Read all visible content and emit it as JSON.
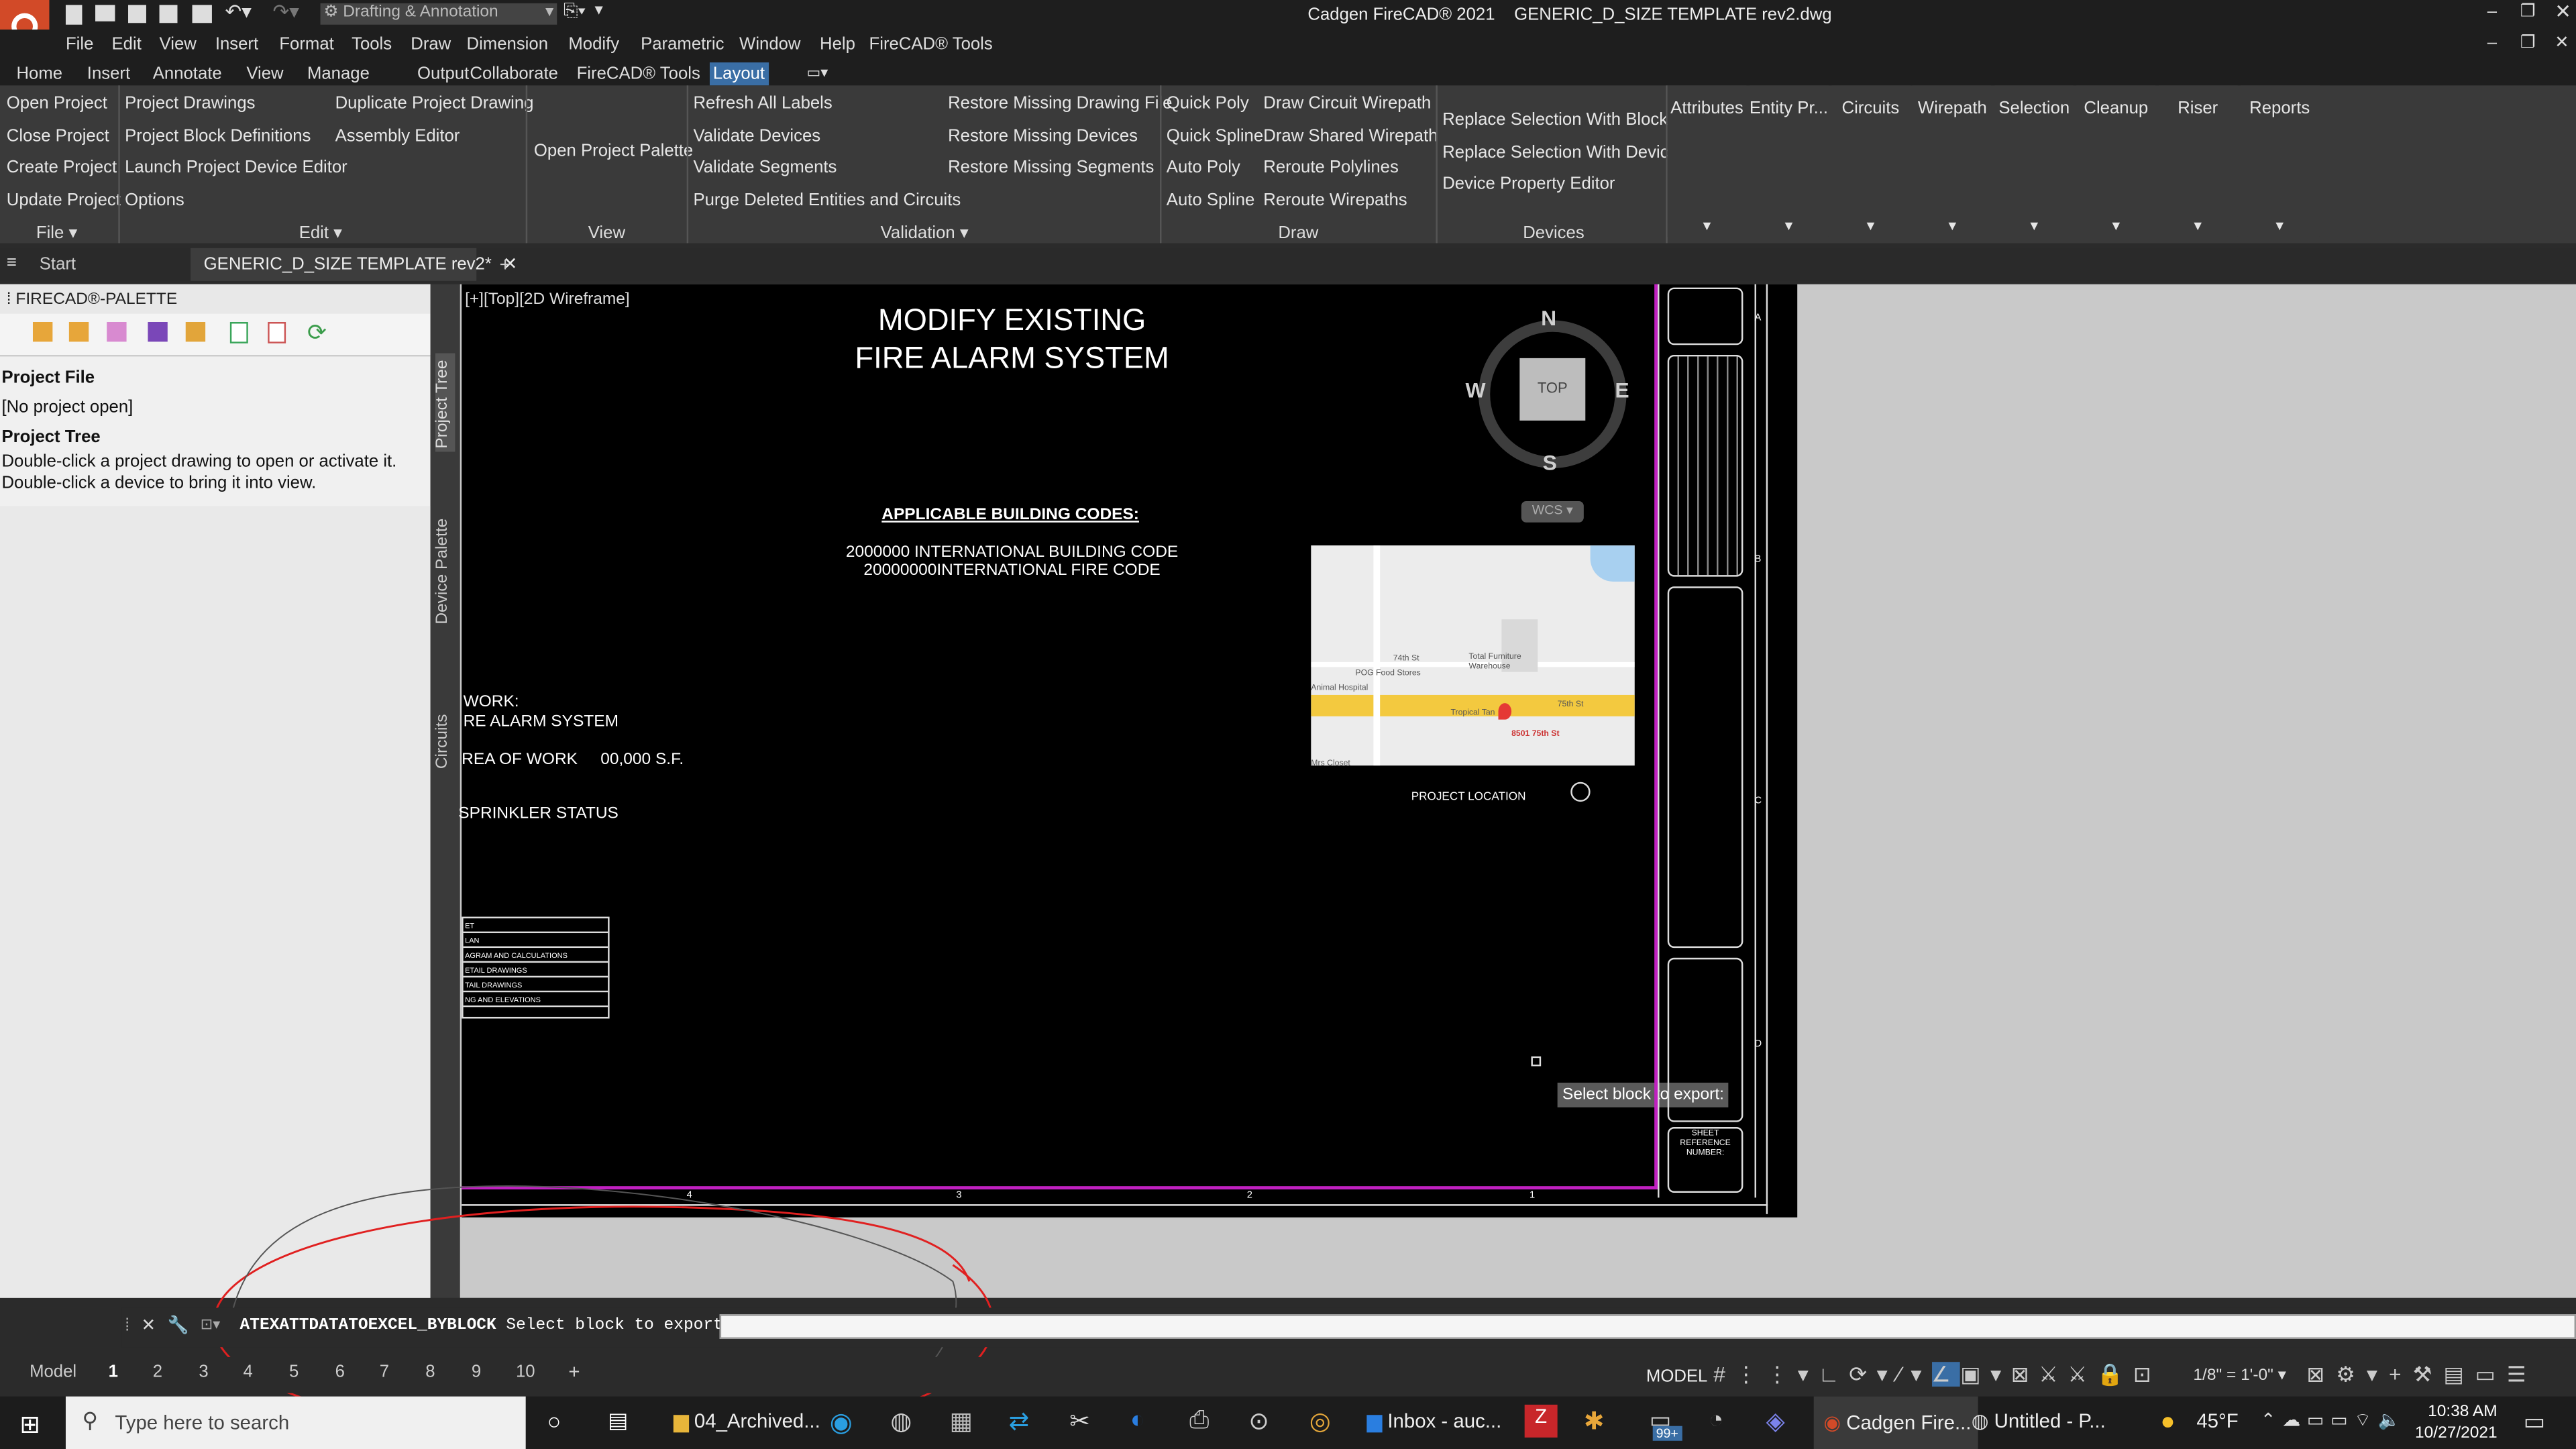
{
  "app": {
    "title": "Cadgen FireCAD® 2021",
    "file": "GENERIC_D_SIZE TEMPLATE rev2.dwg",
    "workspace": "Drafting & Annotation"
  },
  "menu": [
    "File",
    "Edit",
    "View",
    "Insert",
    "Format",
    "Tools",
    "Draw",
    "Dimension",
    "Modify",
    "Parametric",
    "Window",
    "Help",
    "FireCAD® Tools"
  ],
  "ribbon_tabs": [
    "Home",
    "Insert",
    "Annotate",
    "View",
    "Manage",
    "Output",
    "Collaborate",
    "FireCAD® Tools",
    "Layout"
  ],
  "ribbon": {
    "file_items": [
      "Open Project",
      "Close Project",
      "Create Project",
      "Update Project"
    ],
    "file_label": "File",
    "edit_col1": [
      "Project Drawings",
      "Project Block Definitions",
      "Launch Project Device Editor",
      "Options"
    ],
    "edit_col2": [
      "Duplicate Project Drawing",
      "Assembly Editor"
    ],
    "edit_label": "Edit",
    "view_item": "Open Project Palette",
    "view_label": "View",
    "valid_col1": [
      "Refresh All Labels",
      "Validate Devices",
      "Validate Segments",
      "Purge Deleted Entities and Circuits"
    ],
    "valid_col2": [
      "Restore Missing Drawing File",
      "Restore Missing Devices",
      "Restore Missing Segments"
    ],
    "valid_label": "Validation",
    "draw_col1": [
      "Quick Poly",
      "Quick Spline",
      "Auto Poly",
      "Auto Spline"
    ],
    "draw_col2": [
      "Draw Circuit Wirepath",
      "Draw Shared  Wirepath",
      "Reroute Polylines",
      "Reroute Wirepaths"
    ],
    "draw_label": "Draw",
    "dev_items": [
      "Replace Selection With Block",
      "Replace Selection With Device",
      "Device Property Editor"
    ],
    "dev_label": "Devices",
    "dropdowns": [
      "Attributes",
      "Entity Pr...",
      "Circuits",
      "Wirepath",
      "Selection",
      "Cleanup",
      "Riser",
      "Reports"
    ]
  },
  "doc_tabs": {
    "start": "Start",
    "active": "GENERIC_D_SIZE TEMPLATE rev2*"
  },
  "palette": {
    "title": "FIRECAD®-PALETTE",
    "project_file_h": "Project File",
    "project_file_v": "[No project open]",
    "project_tree_h": "Project Tree",
    "hint1": "Double-click a project drawing to open or activate it.",
    "hint2": "Double-click a device to bring it into view.",
    "side_tabs": [
      "Project Tree",
      "Device Palette",
      "Circuits"
    ]
  },
  "drawing": {
    "viewport": "[+][Top][2D Wireframe]",
    "title1": "MODIFY EXISTING",
    "title2": "FIRE ALARM SYSTEM",
    "codes_h": "APPLICABLE BUILDING CODES:",
    "code1": "2000000 INTERNATIONAL BUILDING CODE",
    "code2": "20000000INTERNATIONAL FIRE CODE",
    "work1": "WORK:",
    "work2": "RE ALARM SYSTEM",
    "area_l": "REA OF WORK",
    "area_v": "00,000 S.F.",
    "sprinkler": "SPRINKLER STATUS",
    "sheet_rows": [
      "ET",
      "LAN",
      "AGRAM AND CALCULATIONS",
      "ETAIL DRAWINGS",
      "TAIL DRAWINGS",
      "NG AND ELEVATIONS"
    ],
    "compass": {
      "n": "N",
      "s": "S",
      "e": "E",
      "w": "W",
      "top": "TOP",
      "wcs": "WCS"
    },
    "map": {
      "street1": "74th St",
      "street2": "75th St",
      "poi1": "POG Food Stores",
      "poi2": "Total Furniture Warehouse",
      "poi3": "Tropical Tan",
      "addr": "8501 75th St",
      "poi4": "Animal Hospital",
      "poi5": "Mrs Closet"
    },
    "project_location": "PROJECT LOCATION",
    "tooltip": "Select block to export:",
    "sheet_ref": "SHEET REFERENCE NUMBER:",
    "bottom_nums": [
      "4",
      "3",
      "2",
      "1"
    ],
    "side_letters": [
      "A",
      "B",
      "C",
      "D"
    ]
  },
  "command": {
    "cmd": "ATEXATTDATATOEXCEL_BYBLOCK",
    "prompt": "Select block to export:"
  },
  "layout_tabs": [
    "Model",
    "1",
    "2",
    "3",
    "4",
    "5",
    "6",
    "7",
    "8",
    "9",
    "10"
  ],
  "status": {
    "model": "MODEL",
    "scale": "1/8\" = 1'-0\""
  },
  "taskbar": {
    "search": "Type here to search",
    "items": [
      "04_Archived...",
      "Inbox - auc...",
      "Cadgen Fire...",
      "Untitled - P..."
    ],
    "badge": "99+",
    "temp": "45°F",
    "time": "10:38 AM",
    "date": "10/27/2021"
  },
  "colors": {
    "accent": "#3a6ea5",
    "ribbon": "#3a3a3a",
    "magenta": "#c020c0",
    "annot": "#e02020"
  }
}
